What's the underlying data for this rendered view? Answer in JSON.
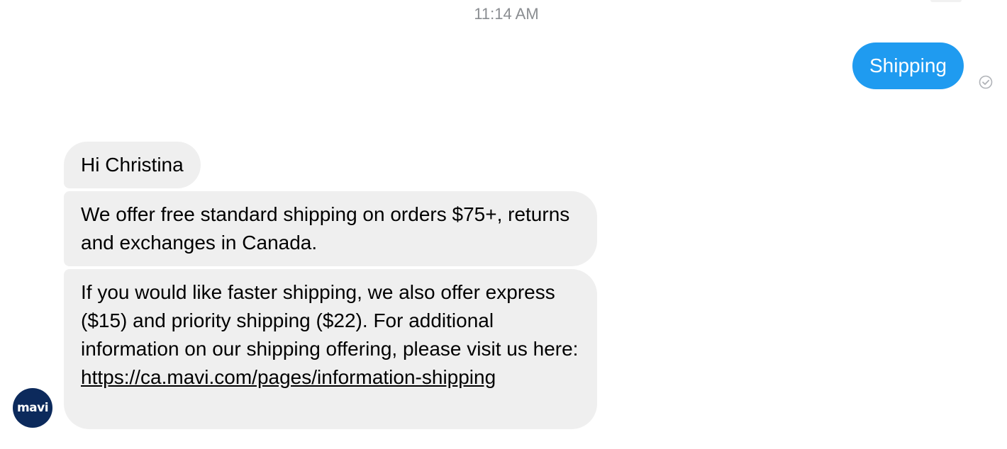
{
  "conversation": {
    "timestamp": "11:14 AM",
    "sent_message": "Shipping",
    "status_icon": "seen-check-icon",
    "bot_avatar_text": "mavi",
    "received_messages": [
      {
        "text": "Hi Christina"
      },
      {
        "text": "We offer free standard shipping on orders $75+, returns and exchanges in Canada."
      },
      {
        "text": "If you would like faster shipping, we also offer express ($15) and priority shipping ($22). For additional information on our shipping offering, please visit us here:",
        "link": "https://ca.mavi.com/pages/information-shipping"
      }
    ]
  },
  "colors": {
    "sent_bubble": "#1f9bf0",
    "received_bubble": "#efefef",
    "avatar_bg": "#0c2a5c",
    "timestamp_text": "#8a8d91"
  }
}
